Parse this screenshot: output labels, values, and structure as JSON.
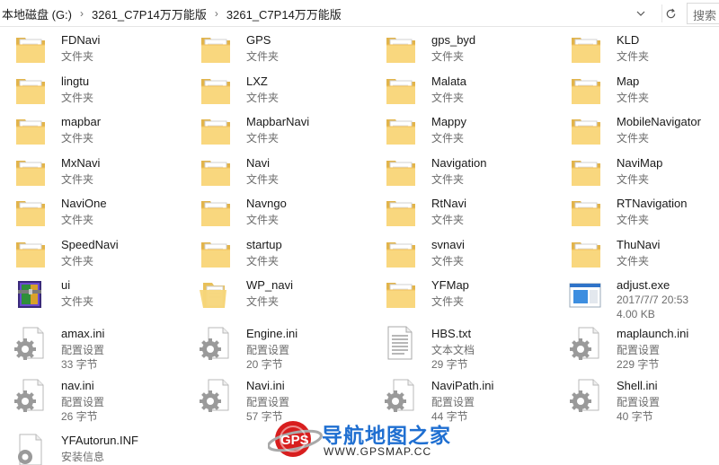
{
  "address": {
    "crumbs": [
      "本地磁盘 (G:)",
      "3261_C7P14万万能版",
      "3261_C7P14万万能版"
    ],
    "search_placeholder": "搜索"
  },
  "items": [
    {
      "name": "FDNavi",
      "type": "文件夹",
      "icon": "folder-icon"
    },
    {
      "name": "GPS",
      "type": "文件夹",
      "icon": "folder-icon"
    },
    {
      "name": "gps_byd",
      "type": "文件夹",
      "icon": "folder-icon"
    },
    {
      "name": "KLD",
      "type": "文件夹",
      "icon": "folder-icon"
    },
    {
      "name": "lingtu",
      "type": "文件夹",
      "icon": "folder-icon"
    },
    {
      "name": "LXZ",
      "type": "文件夹",
      "icon": "folder-icon"
    },
    {
      "name": "Malata",
      "type": "文件夹",
      "icon": "folder-icon"
    },
    {
      "name": "Map",
      "type": "文件夹",
      "icon": "folder-icon"
    },
    {
      "name": "mapbar",
      "type": "文件夹",
      "icon": "folder-icon"
    },
    {
      "name": "MapbarNavi",
      "type": "文件夹",
      "icon": "folder-icon"
    },
    {
      "name": "Mappy",
      "type": "文件夹",
      "icon": "folder-icon"
    },
    {
      "name": "MobileNavigator",
      "type": "文件夹",
      "icon": "folder-icon"
    },
    {
      "name": "MxNavi",
      "type": "文件夹",
      "icon": "folder-icon"
    },
    {
      "name": "Navi",
      "type": "文件夹",
      "icon": "folder-icon"
    },
    {
      "name": "Navigation",
      "type": "文件夹",
      "icon": "folder-icon"
    },
    {
      "name": "NaviMap",
      "type": "文件夹",
      "icon": "folder-icon"
    },
    {
      "name": "NaviOne",
      "type": "文件夹",
      "icon": "folder-icon"
    },
    {
      "name": "Navngo",
      "type": "文件夹",
      "icon": "folder-icon"
    },
    {
      "name": "RtNavi",
      "type": "文件夹",
      "icon": "folder-icon"
    },
    {
      "name": "RTNavigation",
      "type": "文件夹",
      "icon": "folder-icon"
    },
    {
      "name": "SpeedNavi",
      "type": "文件夹",
      "icon": "folder-icon"
    },
    {
      "name": "startup",
      "type": "文件夹",
      "icon": "folder-icon"
    },
    {
      "name": "svnavi",
      "type": "文件夹",
      "icon": "folder-icon"
    },
    {
      "name": "ThuNavi",
      "type": "文件夹",
      "icon": "folder-icon"
    },
    {
      "name": "ui",
      "type": "文件夹",
      "icon": "winrar-archive-icon"
    },
    {
      "name": "WP_navi",
      "type": "文件夹",
      "icon": "open-folder-icon"
    },
    {
      "name": "YFMap",
      "type": "文件夹",
      "icon": "folder-icon"
    },
    {
      "name": "adjust.exe",
      "type": "2017/7/7 20:53",
      "size": "4.00 KB",
      "icon": "application-window-icon"
    },
    {
      "name": "amax.ini",
      "type": "配置设置",
      "size": "33 字节",
      "icon": "gear-settings-file-icon"
    },
    {
      "name": "Engine.ini",
      "type": "配置设置",
      "size": "20 字节",
      "icon": "gear-settings-file-icon"
    },
    {
      "name": "HBS.txt",
      "type": "文本文档",
      "size": "29 字节",
      "icon": "text-document-icon"
    },
    {
      "name": "maplaunch.ini",
      "type": "配置设置",
      "size": "229 字节",
      "icon": "gear-settings-file-icon"
    },
    {
      "name": "nav.ini",
      "type": "配置设置",
      "size": "26 字节",
      "icon": "gear-settings-file-icon"
    },
    {
      "name": "Navi.ini",
      "type": "配置设置",
      "size": "57 字节",
      "icon": "gear-settings-file-icon"
    },
    {
      "name": "NaviPath.ini",
      "type": "配置设置",
      "size": "44 字节",
      "icon": "gear-settings-file-icon"
    },
    {
      "name": "Shell.ini",
      "type": "配置设置",
      "size": "40 字节",
      "icon": "gear-settings-file-icon"
    },
    {
      "name": "YFAutorun.INF",
      "type": "安装信息",
      "icon": "setup-information-file-icon"
    }
  ],
  "watermark": {
    "logo_text": "GPS",
    "title": "导航地图之家",
    "url": "WWW.GPSMAP.CC"
  }
}
